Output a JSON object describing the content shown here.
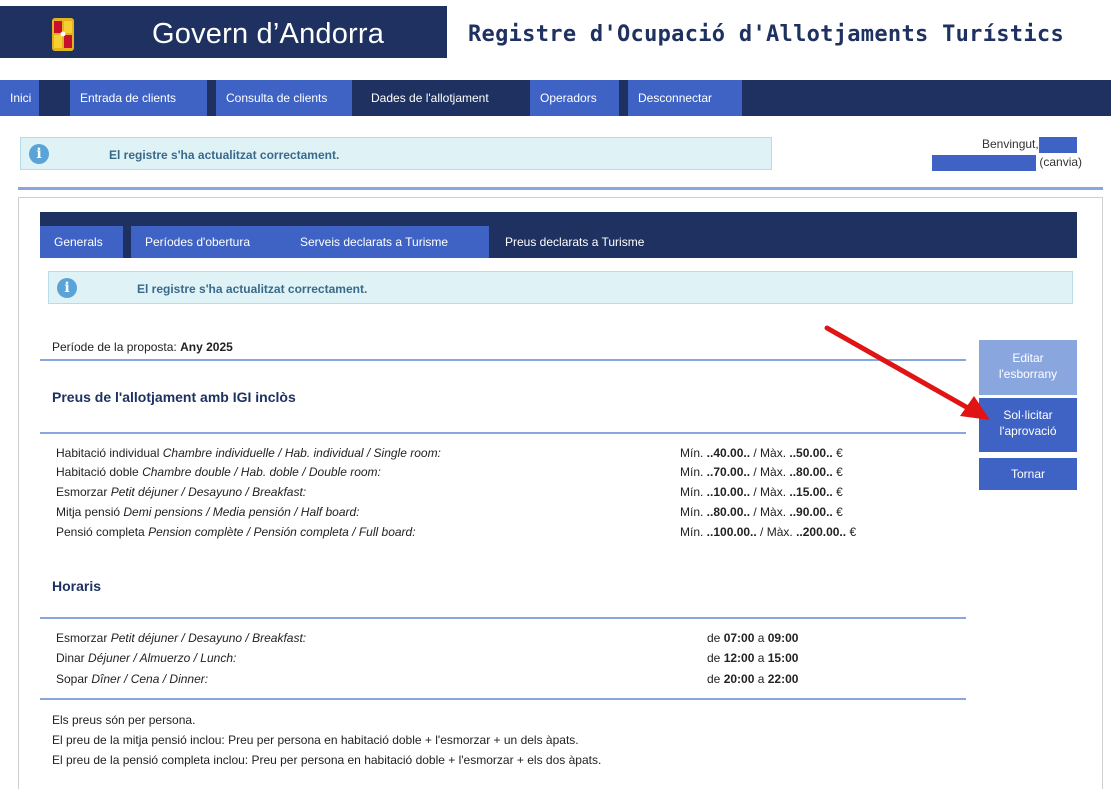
{
  "header": {
    "gov_name": "Govern d’Andorra",
    "site_title": "Registre d'Ocupació d'Allotjaments Turístics"
  },
  "main_nav": {
    "tabs": [
      {
        "label": "Inici",
        "active": false
      },
      {
        "label": "Entrada de clients",
        "active": false
      },
      {
        "label": "Consulta de clients",
        "active": false
      },
      {
        "label": "Dades de l'allotjament",
        "active": true
      },
      {
        "label": "Operadors",
        "active": false
      },
      {
        "label": "Desconnectar",
        "active": false
      }
    ]
  },
  "top_message": "El registre s'ha actualitzat correctament.",
  "user": {
    "welcome": "Benvingut,",
    "change": "(canvia)"
  },
  "sub_nav": {
    "tabs": [
      {
        "label": "Generals",
        "active": false
      },
      {
        "label": "Períodes d'obertura",
        "active": false
      },
      {
        "label": "Serveis declarats a Turisme",
        "active": false
      },
      {
        "label": "Preus declarats a Turisme",
        "active": true
      }
    ]
  },
  "panel_message": "El registre s'ha actualitzat correctament.",
  "period": {
    "label": "Període de la proposta:",
    "value": "Any 2025"
  },
  "prices": {
    "title": "Preus de l'allotjament amb IGI inclòs",
    "rows": [
      {
        "ca": "Habitació individual",
        "other": "Chambre individuelle / Hab. individual / Single room:",
        "value_prefix": "Mín. ",
        "min": "..40.00..",
        "sep": " / Màx. ",
        "max": "..50.00..",
        "unit": " €"
      },
      {
        "ca": "Habitació doble",
        "other": "Chambre double / Hab. doble / Double room:",
        "value_prefix": "Mín. ",
        "min": "..70.00..",
        "sep": " / Màx. ",
        "max": "..80.00..",
        "unit": " €"
      },
      {
        "ca": "Esmorzar",
        "other": "Petit déjuner / Desayuno / Breakfast:",
        "value_prefix": "Mín. ",
        "min": "..10.00..",
        "sep": " / Màx. ",
        "max": "..15.00..",
        "unit": " €"
      },
      {
        "ca": "Mitja pensió",
        "other": "Demi pensions / Media pensión / Half board:",
        "value_prefix": "Mín. ",
        "min": "..80.00..",
        "sep": " / Màx. ",
        "max": "..90.00..",
        "unit": " €"
      },
      {
        "ca": "Pensió completa",
        "other": "Pension complète / Pensión completa / Full board:",
        "value_prefix": "Mín. ",
        "min": "..100.00..",
        "sep": " / Màx. ",
        "max": "..200.00..",
        "unit": " €"
      }
    ]
  },
  "hours": {
    "title": "Horaris",
    "rows": [
      {
        "ca": "Esmorzar",
        "other": "Petit déjuner / Desayuno / Breakfast:",
        "from_label": "de ",
        "from": "07:00",
        "to_label": " a ",
        "to": "09:00"
      },
      {
        "ca": "Dinar",
        "other": "Déjuner / Almuerzo / Lunch:",
        "from_label": "de ",
        "from": "12:00",
        "to_label": " a ",
        "to": "15:00"
      },
      {
        "ca": "Sopar",
        "other": "Dîner / Cena / Dinner:",
        "from_label": "de ",
        "from": "20:00",
        "to_label": " a ",
        "to": "22:00"
      }
    ]
  },
  "notes": [
    "Els preus són per persona.",
    "El preu de la mitja pensió inclou: Preu per persona en habitació doble + l'esmorzar + un dels àpats.",
    "El preu de la pensió completa inclou: Preu per persona en habitació doble + l'esmorzar + els dos àpats."
  ],
  "buttons": {
    "edit_line1": "Editar",
    "edit_line2": "l'esborrany",
    "request_line1": "Sol·licitar",
    "request_line2": "l'aprovació",
    "back": "Tornar"
  },
  "colors": {
    "navy": "#1e3160",
    "tab_blue": "#3f63c5",
    "light_button": "#8aa6df",
    "info_bg": "#dff3f7",
    "arrow": "#e01414"
  }
}
